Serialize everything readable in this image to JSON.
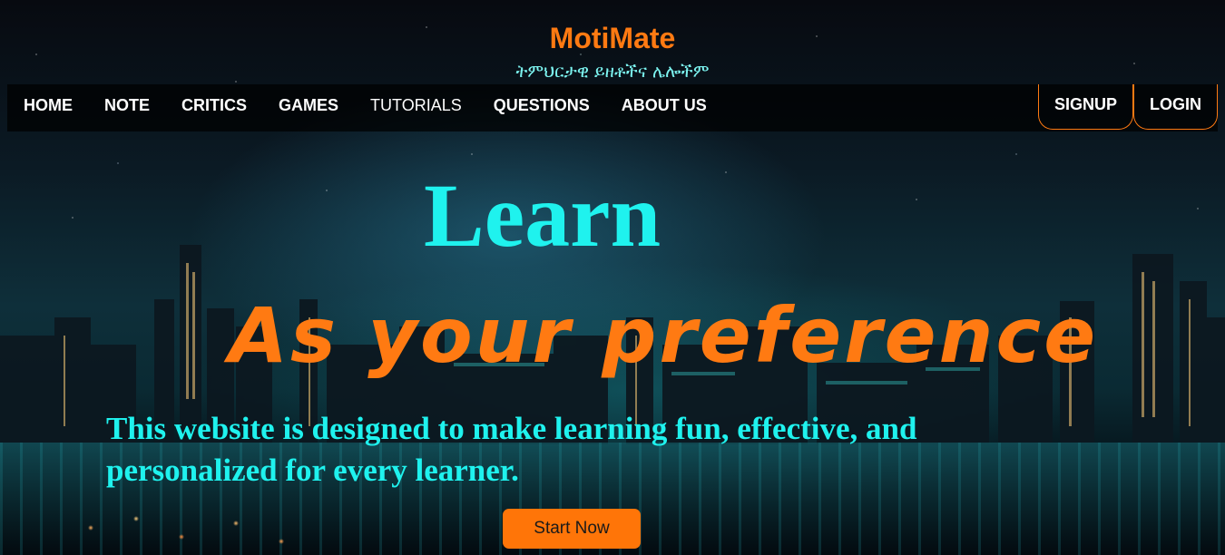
{
  "brand": {
    "title": "MotiMate",
    "subtitle": "ትምህርታዊ ይዘቶችና ሌሎችም"
  },
  "nav": {
    "items": [
      {
        "label": "HOME"
      },
      {
        "label": "NOTE"
      },
      {
        "label": "CRITICS"
      },
      {
        "label": "GAMES"
      },
      {
        "label": "TUTORIALS"
      },
      {
        "label": "QUESTIONS"
      },
      {
        "label": "ABOUT US"
      }
    ],
    "signup_label": "SIGNUP",
    "login_label": "LOGIN"
  },
  "hero": {
    "title": "Learn",
    "subtitle": "As your preference",
    "description": "This website is designed to make learning fun, effective, and personalized for every learner.",
    "cta_label": "Start Now"
  },
  "colors": {
    "accent_orange": "#ff7a12",
    "accent_cyan": "#1ff2ee",
    "navbar_bg": "#000000"
  }
}
